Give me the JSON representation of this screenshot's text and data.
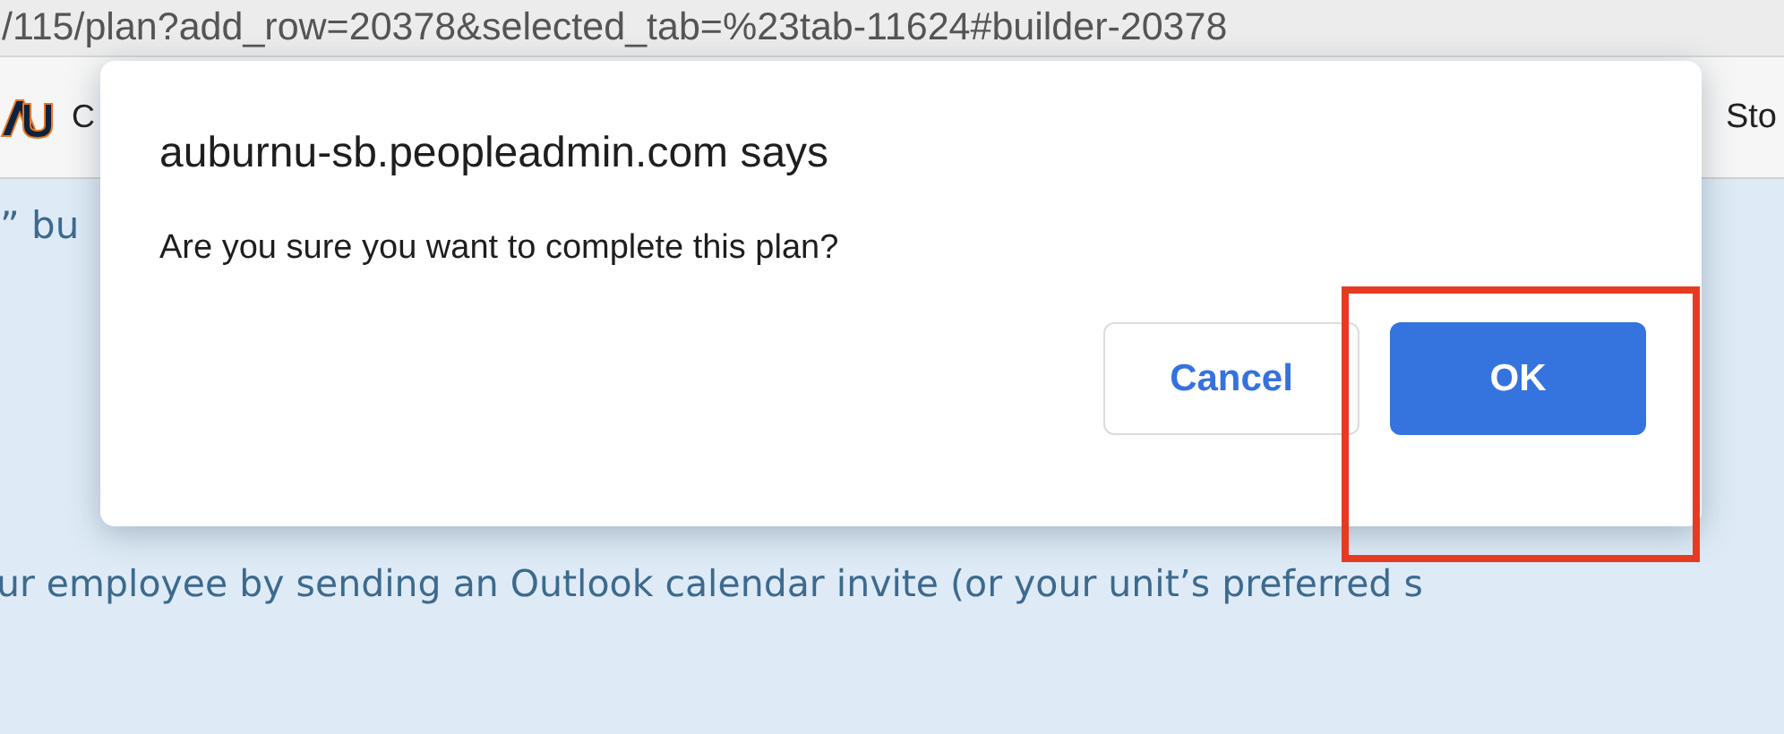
{
  "browser": {
    "url": "/115/plan?add_row=20378&selected_tab=%23tab-11624#builder-20378",
    "bookmarks": [
      {
        "label": "C",
        "kind": "logo"
      },
      {
        "label": "Sto",
        "kind": "plain"
      }
    ]
  },
  "page": {
    "lines": [
      "” bu",
      "ur employee by sending an Outlook calendar invite (or your unit’s preferred s"
    ]
  },
  "dialog": {
    "title": "auburnu-sb.peopleadmin.com says",
    "message": "Are you sure you want to complete this plan?",
    "buttons": [
      {
        "label": "Cancel",
        "kind": "secondary"
      },
      {
        "label": "OK",
        "kind": "primary"
      }
    ]
  },
  "annotation": {
    "kind": "rectangle",
    "color": "#e63b23"
  }
}
